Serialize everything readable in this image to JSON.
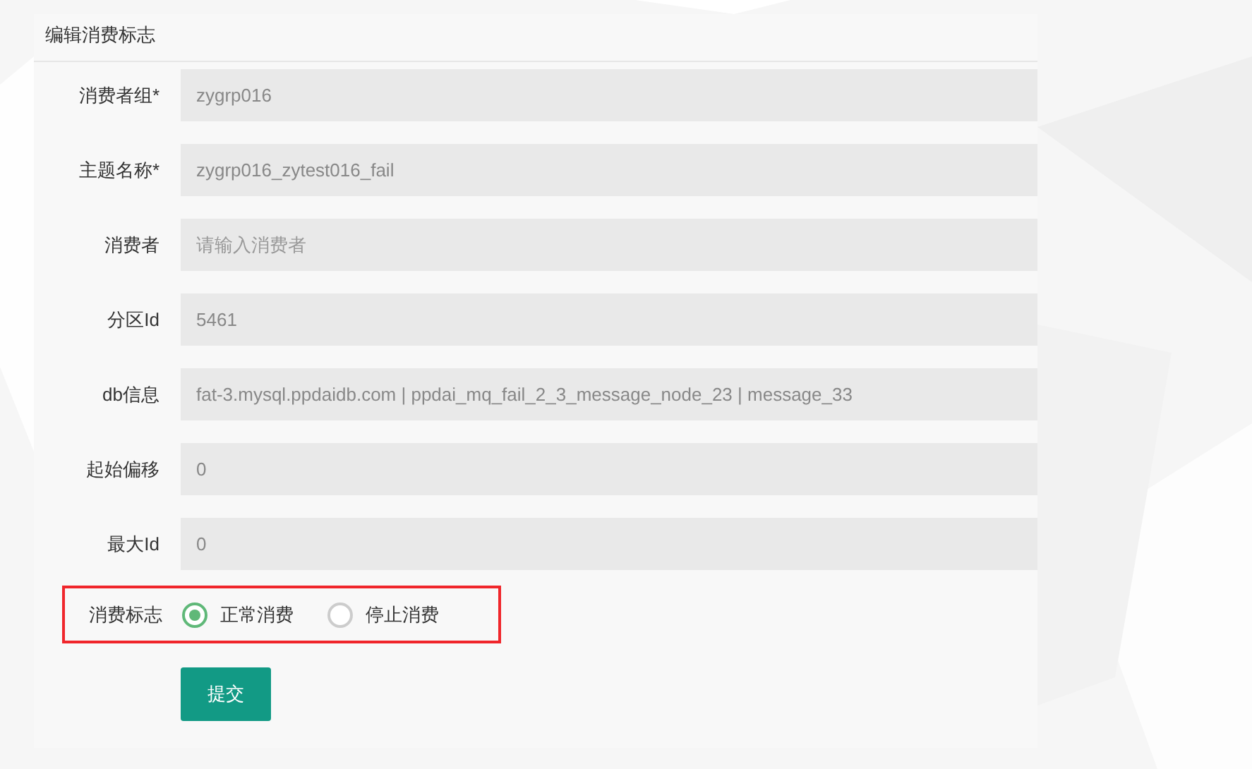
{
  "panel": {
    "title": "编辑消费标志"
  },
  "fields": [
    {
      "label": "消费者组*",
      "value": "zygrp016"
    },
    {
      "label": "主题名称*",
      "value": "zygrp016_zytest016_fail"
    },
    {
      "label": "消费者",
      "placeholder": "请输入消费者"
    },
    {
      "label": "分区Id",
      "value": "5461"
    },
    {
      "label": "db信息",
      "value": "fat-3.mysql.ppdaidb.com | ppdai_mq_fail_2_3_message_node_23 | message_33"
    },
    {
      "label": "起始偏移",
      "value": "0"
    },
    {
      "label": "最大Id",
      "value": "0"
    }
  ],
  "consume_flag": {
    "label": "消费标志",
    "highlighted": true,
    "options": [
      {
        "label": "正常消费",
        "selected": true
      },
      {
        "label": "停止消费",
        "selected": false
      }
    ]
  },
  "submit_button": "提交"
}
